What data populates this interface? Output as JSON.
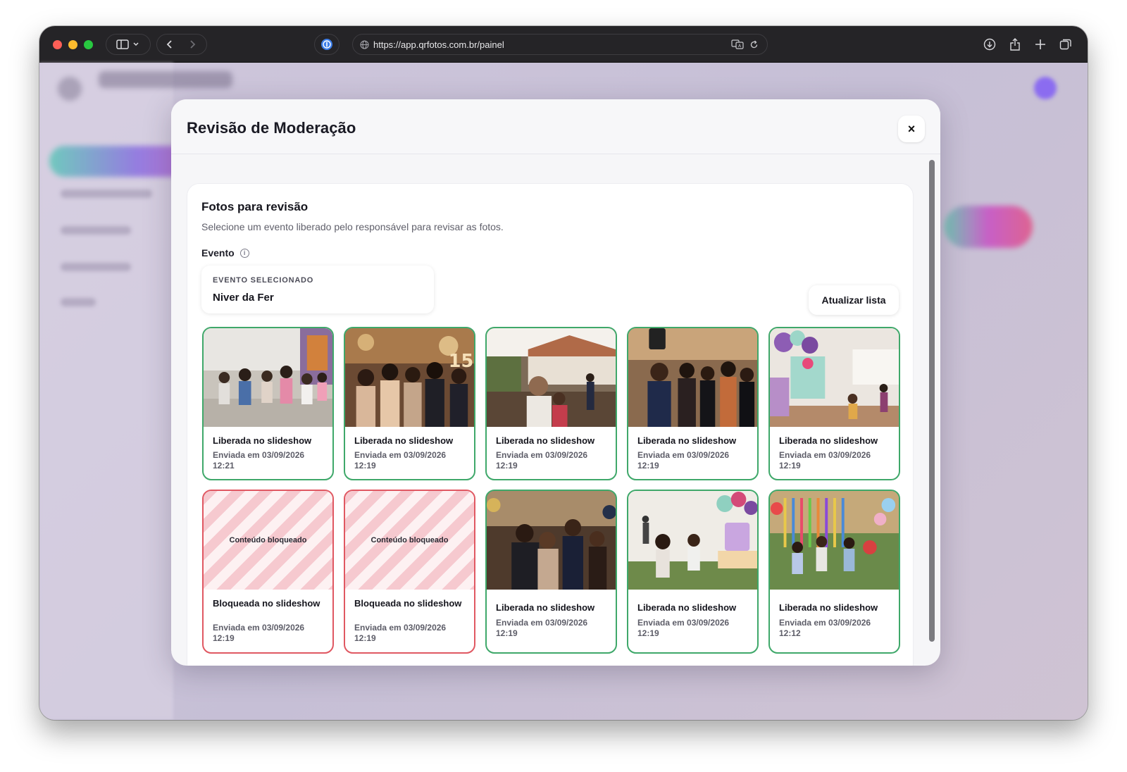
{
  "browser": {
    "url": "https://app.qrfotos.com.br/painel"
  },
  "modal": {
    "title": "Revisão de Moderação",
    "close_label": "×"
  },
  "review": {
    "title": "Fotos para revisão",
    "subtitle": "Selecione um evento liberado pelo responsável para revisar as fotos.",
    "event_label": "Evento",
    "selected_key": "EVENTO SELECIONADO",
    "selected_value": "Niver da Fer",
    "refresh_label": "Atualizar lista",
    "blocked_overlay": "Conteúdo bloqueado"
  },
  "photos": [
    {
      "status": "Liberada no slideshow",
      "sent": "Enviada em 03/09/2026",
      "time": "12:21",
      "state": "ok",
      "scene": "kids-party"
    },
    {
      "status": "Liberada no slideshow",
      "sent": "Enviada em 03/09/2026",
      "time": "12:19",
      "state": "ok",
      "scene": "fifteen-party"
    },
    {
      "status": "Liberada no slideshow",
      "sent": "Enviada em 03/09/2026",
      "time": "12:19",
      "state": "ok",
      "scene": "garden-dinner"
    },
    {
      "status": "Liberada no slideshow",
      "sent": "Enviada em 03/09/2026",
      "time": "12:19",
      "state": "ok",
      "scene": "selfie-group"
    },
    {
      "status": "Liberada no slideshow",
      "sent": "Enviada em 03/09/2026",
      "time": "12:19",
      "state": "ok",
      "scene": "balloon-room"
    },
    {
      "status": "Bloqueada no slideshow",
      "sent": "Enviada em 03/09/2026",
      "time": "12:19",
      "state": "blocked",
      "scene": ""
    },
    {
      "status": "Bloqueada no slideshow",
      "sent": "Enviada em 03/09/2026",
      "time": "12:19",
      "state": "blocked",
      "scene": ""
    },
    {
      "status": "Liberada no slideshow",
      "sent": "Enviada em 03/09/2026",
      "time": "12:19",
      "state": "ok",
      "scene": "hug-party"
    },
    {
      "status": "Liberada no slideshow",
      "sent": "Enviada em 03/09/2026",
      "time": "12:19",
      "state": "ok",
      "scene": "cake-table"
    },
    {
      "status": "Liberada no slideshow",
      "sent": "Enviada em 03/09/2026",
      "time": "12:12",
      "state": "ok",
      "scene": "garden-kids"
    }
  ],
  "colors": {
    "ok_border": "#3fa86a",
    "blocked_border": "#e05862"
  }
}
